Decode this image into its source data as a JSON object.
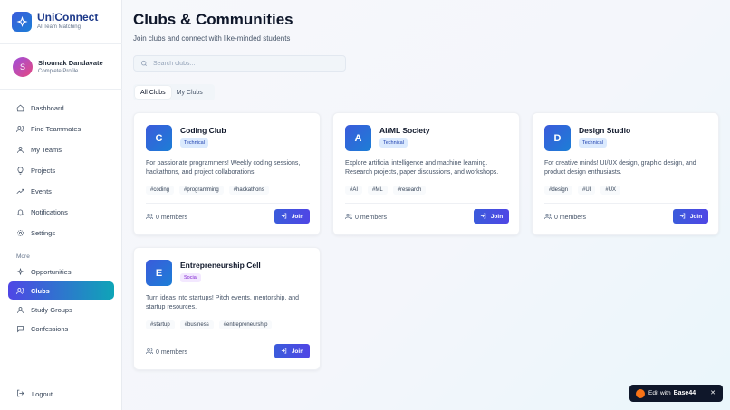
{
  "app": {
    "name": "UniConnect",
    "tagline": "AI Team Matching"
  },
  "user": {
    "initial": "S",
    "name": "Shounak Dandavate",
    "status": "Complete Profile"
  },
  "sidebar": {
    "items": [
      {
        "label": "Dashboard",
        "icon": "home-icon"
      },
      {
        "label": "Find Teammates",
        "icon": "users-icon"
      },
      {
        "label": "My Teams",
        "icon": "user-icon"
      },
      {
        "label": "Projects",
        "icon": "lightbulb-icon"
      },
      {
        "label": "Events",
        "icon": "trending-icon"
      },
      {
        "label": "Notifications",
        "icon": "bell-icon"
      },
      {
        "label": "Settings",
        "icon": "gear-icon"
      }
    ],
    "more_label": "More",
    "more_items": [
      {
        "label": "Opportunities",
        "icon": "sparkle-icon"
      },
      {
        "label": "Clubs",
        "icon": "users-icon",
        "active": true
      },
      {
        "label": "Study Groups",
        "icon": "user-icon"
      },
      {
        "label": "Confessions",
        "icon": "message-icon"
      }
    ],
    "logout_label": "Logout"
  },
  "page": {
    "title": "Clubs & Communities",
    "subtitle": "Join clubs and connect with like-minded students"
  },
  "search": {
    "placeholder": "Search clubs...",
    "value": ""
  },
  "tabs": [
    {
      "label": "All Clubs",
      "active": true
    },
    {
      "label": "My Clubs",
      "active": false
    }
  ],
  "clubs": [
    {
      "initial": "C",
      "name": "Coding Club",
      "category": "Technical",
      "description": "For passionate programmers! Weekly coding sessions, hackathons, and project collaborations.",
      "tags": [
        "#coding",
        "#programming",
        "#hackathons"
      ],
      "members": "0 members",
      "join_label": "Join"
    },
    {
      "initial": "A",
      "name": "AI/ML Society",
      "category": "Technical",
      "description": "Explore artificial intelligence and machine learning. Research projects, paper discussions, and workshops.",
      "tags": [
        "#AI",
        "#ML",
        "#research"
      ],
      "members": "0 members",
      "join_label": "Join"
    },
    {
      "initial": "D",
      "name": "Design Studio",
      "category": "Technical",
      "description": "For creative minds! UI/UX design, graphic design, and product design enthusiasts.",
      "tags": [
        "#design",
        "#UI",
        "#UX"
      ],
      "members": "0 members",
      "join_label": "Join"
    },
    {
      "initial": "E",
      "name": "Entrepreneurship Cell",
      "category": "Social",
      "description": "Turn ideas into startups! Pitch events, mentorship, and startup resources.",
      "tags": [
        "#startup",
        "#business",
        "#entrepreneurship"
      ],
      "members": "0 members",
      "join_label": "Join"
    }
  ],
  "badge": {
    "prefix": "Edit with",
    "brand": "Base44",
    "close": "✕"
  },
  "colors": {
    "accent": "#4f46e5",
    "active_gradient_end": "#0ea5b7",
    "technical_badge_bg": "#dbeafe",
    "social_badge_bg": "#f3e8ff"
  }
}
